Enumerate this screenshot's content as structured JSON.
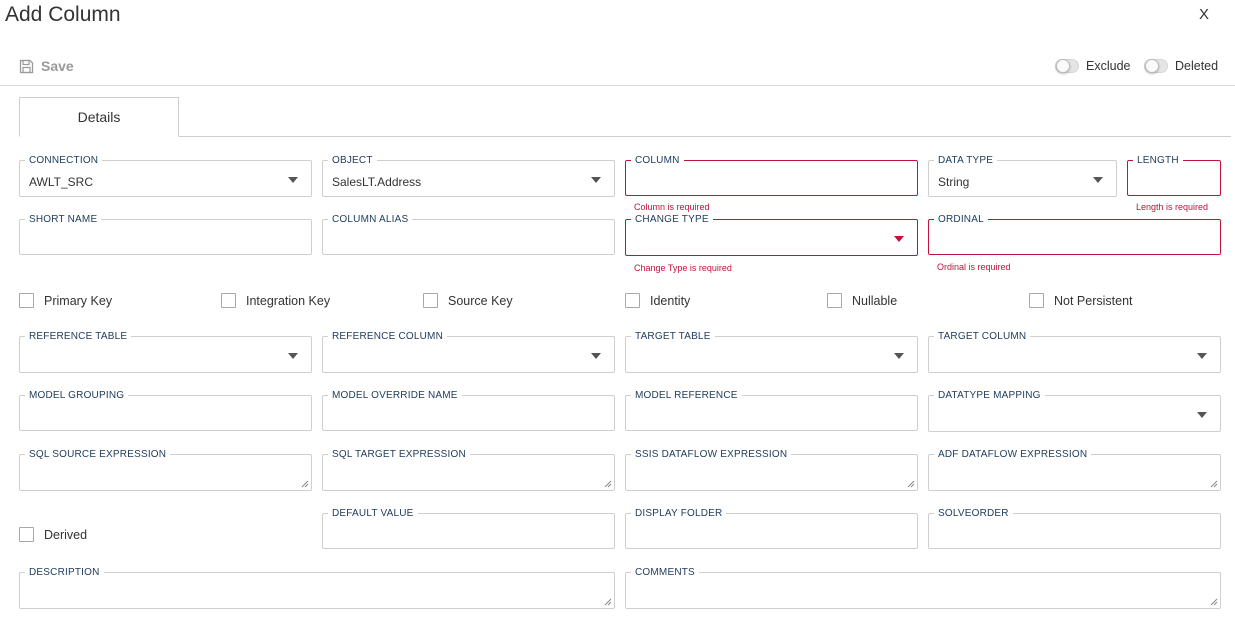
{
  "header": {
    "title": "Add Column",
    "close_label": "X"
  },
  "toolbar": {
    "save_label": "Save",
    "exclude_label": "Exclude",
    "deleted_label": "Deleted",
    "exclude_on": false,
    "deleted_on": false
  },
  "tabs": [
    {
      "label": "Details",
      "active": true
    }
  ],
  "fields": {
    "connection": {
      "label": "CONNECTION",
      "value": "AWLT_SRC"
    },
    "object": {
      "label": "OBJECT",
      "value": "SalesLT.Address"
    },
    "column": {
      "label": "COLUMN",
      "value": "",
      "error": "Column is required"
    },
    "data_type": {
      "label": "DATA TYPE",
      "value": "String"
    },
    "length": {
      "label": "LENGTH",
      "value": "",
      "error": "Length is required"
    },
    "short_name": {
      "label": "SHORT NAME",
      "value": ""
    },
    "column_alias": {
      "label": "COLUMN ALIAS",
      "value": ""
    },
    "change_type": {
      "label": "CHANGE TYPE",
      "value": "",
      "error": "Change Type is required"
    },
    "ordinal": {
      "label": "ORDINAL",
      "value": "",
      "error": "Ordinal is required"
    },
    "reference_table": {
      "label": "REFERENCE TABLE",
      "value": ""
    },
    "reference_column": {
      "label": "REFERENCE COLUMN",
      "value": ""
    },
    "target_table": {
      "label": "TARGET TABLE",
      "value": ""
    },
    "target_column": {
      "label": "TARGET COLUMN",
      "value": ""
    },
    "model_grouping": {
      "label": "MODEL GROUPING",
      "value": ""
    },
    "model_override_name": {
      "label": "MODEL OVERRIDE NAME",
      "value": ""
    },
    "model_reference": {
      "label": "MODEL REFERENCE",
      "value": ""
    },
    "datatype_mapping": {
      "label": "DATATYPE MAPPING",
      "value": ""
    },
    "sql_source_expression": {
      "label": "SQL SOURCE EXPRESSION",
      "value": ""
    },
    "sql_target_expression": {
      "label": "SQL TARGET EXPRESSION",
      "value": ""
    },
    "ssis_dataflow_expression": {
      "label": "SSIS DATAFLOW EXPRESSION",
      "value": ""
    },
    "adf_dataflow_expression": {
      "label": "ADF DATAFLOW EXPRESSION",
      "value": ""
    },
    "default_value": {
      "label": "DEFAULT VALUE",
      "value": ""
    },
    "display_folder": {
      "label": "DISPLAY FOLDER",
      "value": ""
    },
    "solveorder": {
      "label": "SOLVEORDER",
      "value": ""
    },
    "description": {
      "label": "DESCRIPTION",
      "value": ""
    },
    "comments": {
      "label": "COMMENTS",
      "value": ""
    }
  },
  "checkboxes": {
    "primary_key": {
      "label": "Primary Key",
      "checked": false
    },
    "integration_key": {
      "label": "Integration Key",
      "checked": false
    },
    "source_key": {
      "label": "Source Key",
      "checked": false
    },
    "identity": {
      "label": "Identity",
      "checked": false
    },
    "nullable": {
      "label": "Nullable",
      "checked": false
    },
    "not_persistent": {
      "label": "Not Persistent",
      "checked": false
    },
    "derived": {
      "label": "Derived",
      "checked": false
    }
  },
  "colors": {
    "error": "#c2123b",
    "label": "#1e3a5a",
    "border": "#cfcfcf"
  }
}
